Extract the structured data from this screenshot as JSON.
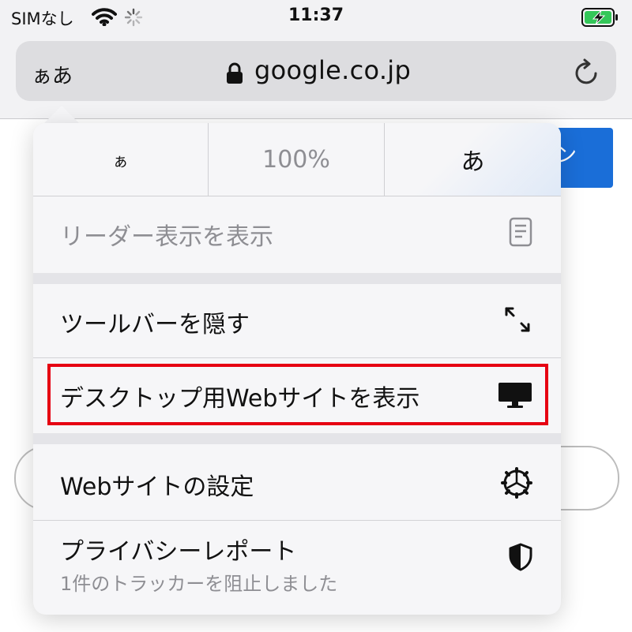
{
  "status_bar": {
    "carrier": "SIMなし",
    "time": "11:37",
    "icons": [
      "wifi-icon",
      "loading-spinner-icon",
      "battery-charging-icon"
    ]
  },
  "address_bar": {
    "text_size_button": "ぁあ",
    "url": "google.co.jp",
    "icons": [
      "lock-icon",
      "reload-icon"
    ]
  },
  "background_page": {
    "button_fragment": "ン"
  },
  "menu": {
    "font_size": {
      "smaller": "ぁ",
      "zoom": "100%",
      "larger": "あ"
    },
    "items": [
      {
        "label": "リーダー表示を表示",
        "icon": "reader-document-icon",
        "disabled": true
      },
      {
        "label": "ツールバーを隠す",
        "icon": "expand-arrows-icon"
      },
      {
        "label": "デスクトップ用Webサイトを表示",
        "icon": "desktop-monitor-icon",
        "highlighted": true
      },
      {
        "label": "Webサイトの設定",
        "icon": "settings-gear-icon"
      },
      {
        "label": "プライバシーレポート",
        "sublabel": "1件のトラッカーを阻止しました",
        "icon": "shield-icon"
      }
    ]
  },
  "colors": {
    "highlight": "#e60012",
    "page_button": "#1a6ed8",
    "disabled_text": "#8e8e93"
  }
}
